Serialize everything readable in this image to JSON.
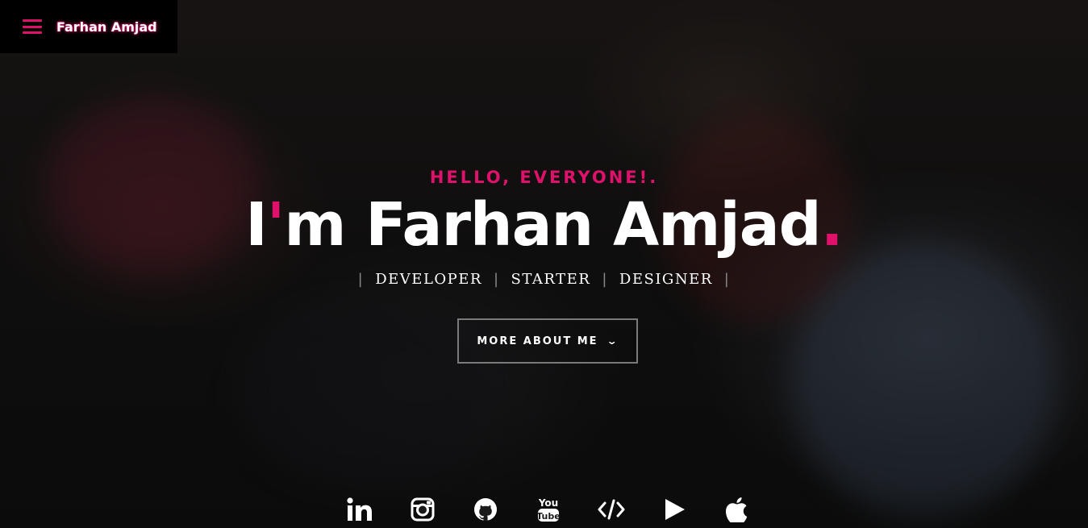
{
  "nav": {
    "brand": "Farhan Amjad"
  },
  "hero": {
    "greeting": "HELLO, EVERYONE!.",
    "headline_prefix": "I",
    "headline_apostrophe": "'",
    "headline_rest": "m Farhan Amjad",
    "headline_dot": ".",
    "roles": [
      "DEVELOPER",
      "STARTER",
      "DESIGNER"
    ],
    "role_separator": "|",
    "more_button": "MORE ABOUT ME"
  },
  "socials": [
    {
      "icon": "linkedin-icon"
    },
    {
      "icon": "instagram-icon"
    },
    {
      "icon": "github-icon"
    },
    {
      "icon": "youtube-icon"
    },
    {
      "icon": "code-icon"
    },
    {
      "icon": "play-store-icon"
    },
    {
      "icon": "apple-icon"
    }
  ],
  "colors": {
    "accent": "#e0116b",
    "text": "#ffffff",
    "menu_bg": "#000000"
  }
}
